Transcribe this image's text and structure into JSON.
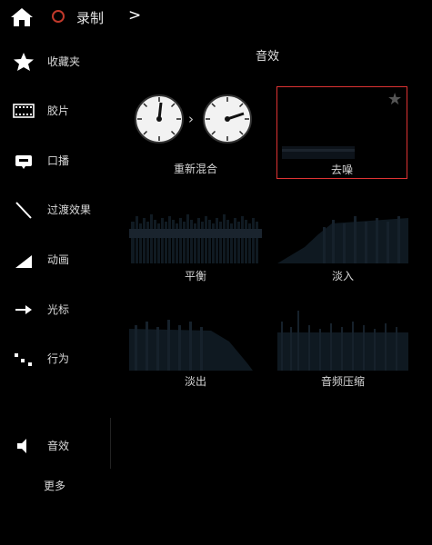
{
  "topbar": {
    "record_label": "录制"
  },
  "sidebar": {
    "items": [
      {
        "label": "收藏夹"
      },
      {
        "label": "胶片"
      },
      {
        "label": "口播"
      },
      {
        "label": "过渡效果"
      },
      {
        "label": "动画"
      },
      {
        "label": "光标"
      },
      {
        "label": "行为"
      },
      {
        "label": "音效"
      },
      {
        "label": "更多"
      }
    ]
  },
  "main": {
    "section_title": "音效",
    "cards": [
      {
        "label": "重新混合"
      },
      {
        "label": "去噪"
      },
      {
        "label": "平衡"
      },
      {
        "label": "淡入"
      },
      {
        "label": "淡出"
      },
      {
        "label": "音频压缩"
      }
    ]
  },
  "colors": {
    "accent": "#d33",
    "record": "#c0392b"
  }
}
